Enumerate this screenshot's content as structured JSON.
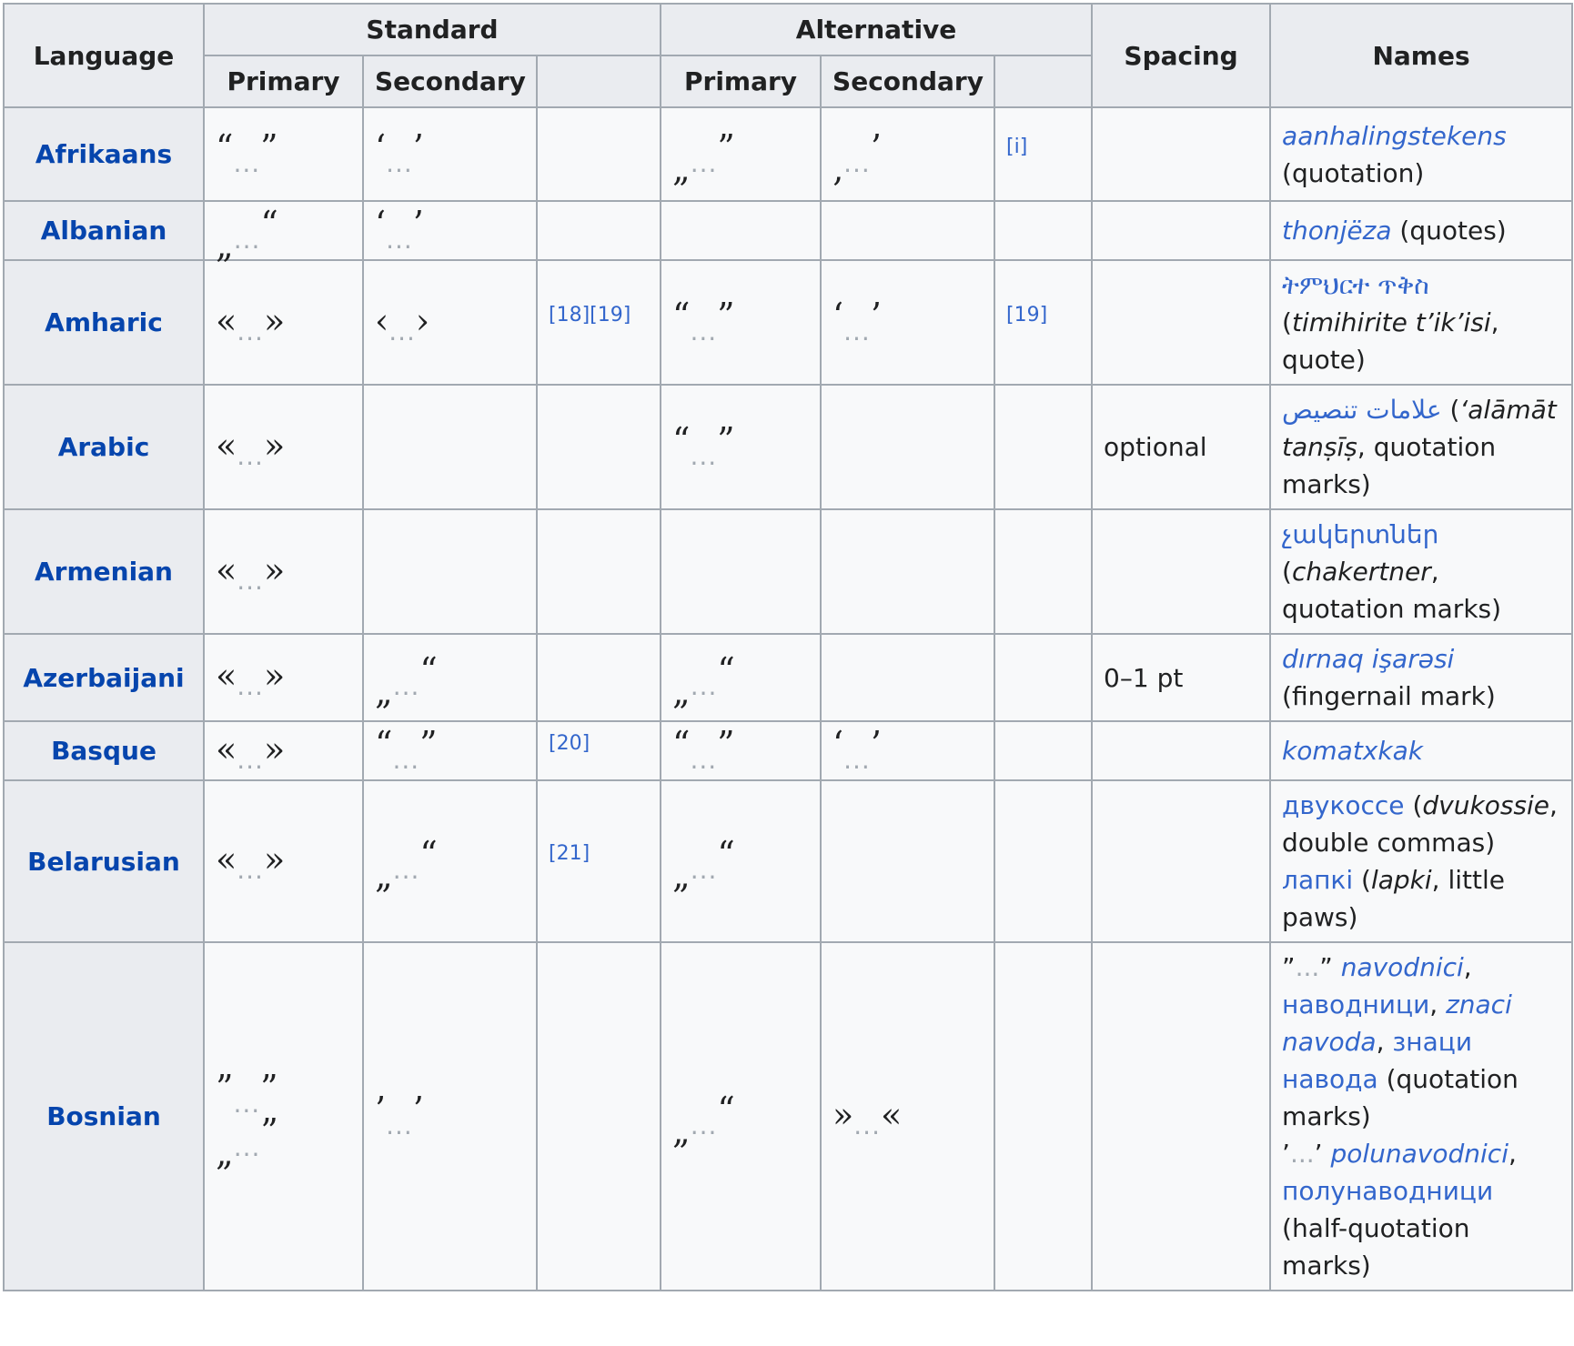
{
  "headers": {
    "language": "Language",
    "standard": "Standard",
    "alternative": "Alternative",
    "spacing": "Spacing",
    "names": "Names",
    "std_primary": "Primary",
    "std_secondary": "Secondary",
    "alt_primary": "Primary",
    "alt_secondary": "Secondary"
  },
  "ellipsis": "...",
  "rows": {
    "afrikaans": {
      "language": "Afrikaans",
      "std_primary": [
        "“",
        "”"
      ],
      "std_secondary": [
        "‘",
        "’"
      ],
      "alt_primary": [
        "„",
        "”"
      ],
      "alt_secondary": [
        "‚",
        "’"
      ],
      "alt_ref": "[i]",
      "name_link": "aanhalingstekens",
      "name_rest": "(quotation)"
    },
    "albanian": {
      "language": "Albanian",
      "std_primary": [
        "„",
        "“"
      ],
      "std_secondary": [
        "‘",
        "’"
      ],
      "name_link": "thonjëza",
      "name_rest": "(quotes)"
    },
    "amharic": {
      "language": "Amharic",
      "std_primary": [
        "«",
        "»"
      ],
      "std_secondary": [
        "‹",
        "›"
      ],
      "std_ref": "[18][19]",
      "alt_primary": [
        "“",
        "”"
      ],
      "alt_secondary": [
        "‘",
        "’"
      ],
      "alt_ref": "[19]",
      "name_native": "ትምህርተ ጥቅስ",
      "name_paren_open": "(",
      "name_translit": "timihirite t’ik’isi",
      "name_rest": ", quote)"
    },
    "arabic": {
      "language": "Arabic",
      "std_primary": [
        "«",
        "»"
      ],
      "alt_primary": [
        "“",
        "”"
      ],
      "spacing": "optional",
      "name_native": "علامات تنصيص",
      "name_paren_open": "(",
      "name_translit": "‘alāmāt tanṣīṣ",
      "name_rest": ", quotation marks)"
    },
    "armenian": {
      "language": "Armenian",
      "std_primary": [
        "«",
        "»"
      ],
      "name_native": "չակերտներ",
      "name_paren_open": "(",
      "name_translit": "chakertner",
      "name_rest": ", quotation marks)"
    },
    "azerbaijani": {
      "language": "Azerbaijani",
      "std_primary": [
        "«",
        "»"
      ],
      "std_secondary": [
        "„",
        "“"
      ],
      "alt_primary": [
        "„",
        "“"
      ],
      "spacing": "0–1 pt",
      "name_link": "dırnaq işarəsi",
      "name_rest": "(fingernail mark)"
    },
    "basque": {
      "language": "Basque",
      "std_primary": [
        "«",
        "»"
      ],
      "std_secondary": [
        "“",
        "”"
      ],
      "std_ref": "[20]",
      "alt_primary": [
        "“",
        "”"
      ],
      "alt_secondary": [
        "‘",
        "’"
      ],
      "name_link": "komatxkak"
    },
    "belarusian": {
      "language": "Belarusian",
      "std_primary": [
        "«",
        "»"
      ],
      "std_secondary": [
        "„",
        "“"
      ],
      "std_ref": "[21]",
      "alt_primary": [
        "„",
        "“"
      ],
      "name1_native": "двукоссе",
      "name1_paren_open": "(",
      "name1_translit": "dvukossie",
      "name1_rest": ", double commas)",
      "name2_native": "лапкі",
      "name2_paren_open": "(",
      "name2_translit": "lapki",
      "name2_rest": ", little paws)"
    },
    "bosnian": {
      "language": "Bosnian",
      "std_primary_a": [
        "”",
        "”"
      ],
      "std_primary_b": [
        "„",
        "”"
      ],
      "std_secondary": [
        "’",
        "’"
      ],
      "alt_primary": [
        "„",
        "“"
      ],
      "alt_secondary": [
        "»",
        "«"
      ],
      "n1_q_open": "”",
      "n1_q_close": "”",
      "n1_link_a": "navodnici",
      "n1_comma_a": ",",
      "n1_link_b": "наводници",
      "n1_comma_b": ",",
      "n1_link_c": "znaci navoda",
      "n1_comma_c": ",",
      "n1_link_d": "знаци навода",
      "n1_rest": "(quotation marks)",
      "n2_q_open": "’",
      "n2_q_close": "’",
      "n2_link_a": "polunavodnici",
      "n2_comma_a": ",",
      "n2_link_b": "полунаводници",
      "n2_rest": "(half-quotation marks)"
    }
  }
}
